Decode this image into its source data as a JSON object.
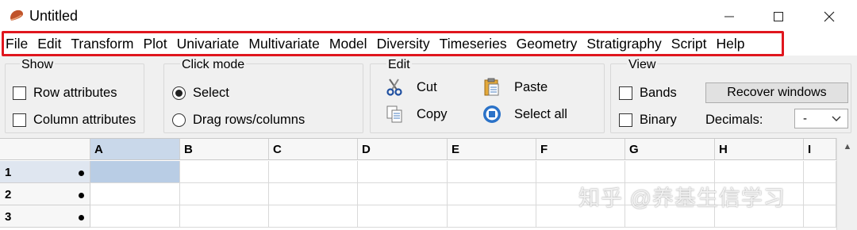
{
  "window": {
    "title": "Untitled",
    "minimize_glyph": "—",
    "maximize_glyph": "☐",
    "close_glyph": "✕"
  },
  "menu": [
    "File",
    "Edit",
    "Transform",
    "Plot",
    "Univariate",
    "Multivariate",
    "Model",
    "Diversity",
    "Timeseries",
    "Geometry",
    "Stratigraphy",
    "Script",
    "Help"
  ],
  "colors": {
    "highlight": "#e0161e",
    "selection": "#b9cde5"
  },
  "show_group": {
    "label": "Show",
    "row_attributes": "Row attributes",
    "column_attributes": "Column attributes"
  },
  "click_mode": {
    "label": "Click mode",
    "select": "Select",
    "drag": "Drag rows/columns",
    "selected": "Select"
  },
  "edit_group": {
    "label": "Edit",
    "cut": "Cut",
    "copy": "Copy",
    "paste": "Paste",
    "select_all": "Select all"
  },
  "view_group": {
    "label": "View",
    "bands": "Bands",
    "binary": "Binary",
    "recover_windows": "Recover windows",
    "decimals_label": "Decimals:",
    "decimals_value": "-"
  },
  "grid": {
    "columns": [
      "A",
      "B",
      "C",
      "D",
      "E",
      "F",
      "G",
      "H",
      "I"
    ],
    "rows": [
      "1",
      "2",
      "3"
    ],
    "selected_cell": "A1"
  },
  "watermark": "知乎 @养基生信学习"
}
